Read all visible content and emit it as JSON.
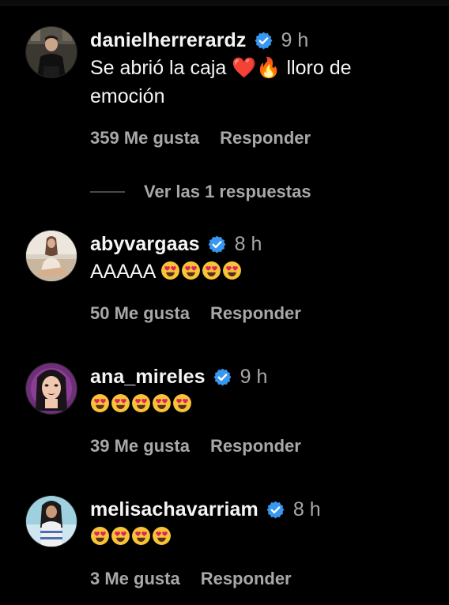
{
  "colors": {
    "background": "#000000",
    "text_primary": "#f5f5f5",
    "text_secondary": "#a8a8a8",
    "verified_blue": "#3897f0"
  },
  "comments": [
    {
      "username": "danielherrerardz",
      "verified": true,
      "time": "9 h",
      "text_line1": "Se abrió la caja",
      "emoji1": "❤️",
      "emoji2": "🔥",
      "text_line1_end": "lloro de",
      "text_line2": "emoción",
      "likes": "359 Me gusta",
      "reply_label": "Responder",
      "view_replies": "Ver las 1 respuestas"
    },
    {
      "username": "abyvargaas",
      "verified": true,
      "time": "8 h",
      "text": "AAAAA",
      "emoji_count": 4,
      "likes": "50 Me gusta",
      "reply_label": "Responder"
    },
    {
      "username": "ana_mireles",
      "verified": true,
      "time": "9 h",
      "emoji_count": 5,
      "likes": "39 Me gusta",
      "reply_label": "Responder"
    },
    {
      "username": "melisachavarriam",
      "verified": true,
      "time": "8 h",
      "emoji_count": 4,
      "likes": "3 Me gusta",
      "reply_label": "Responder"
    }
  ],
  "icons": {
    "verified": "verified-badge-icon",
    "heart_eyes": "smiling-face-with-heart-eyes-emoji"
  }
}
